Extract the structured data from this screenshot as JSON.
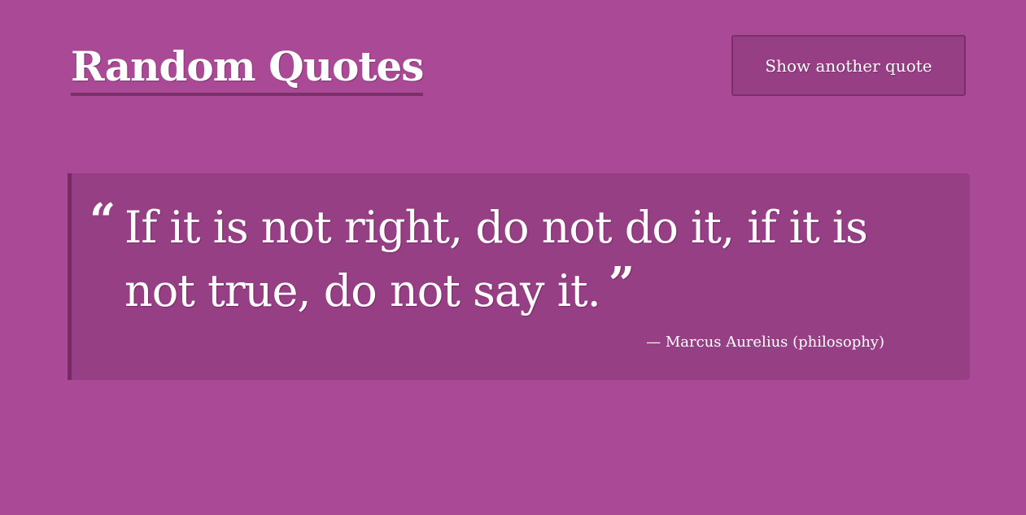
{
  "header": {
    "title": "Random Quotes",
    "button_label": "Show another quote"
  },
  "quote": {
    "open_mark": "“",
    "text": "If it is not right, do not do it, if it is not true, do not say it.",
    "close_mark": "”",
    "dash": "—",
    "author": "Marcus Aurelius (philosophy)"
  },
  "colors": {
    "background": "#aa4a96",
    "card": "#973f85",
    "accent": "#742a65",
    "text": "#ffffff"
  }
}
